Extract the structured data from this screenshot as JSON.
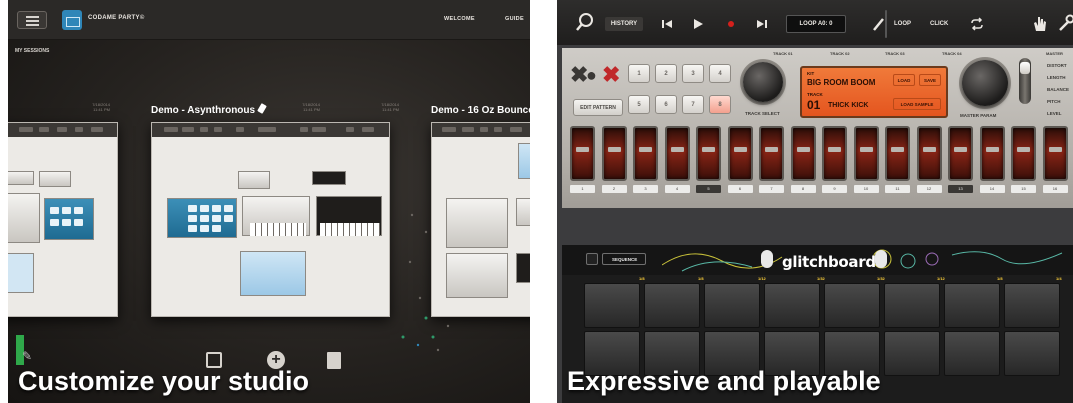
{
  "left_screen": {
    "header": {
      "brand": "CODAME PARTY©",
      "nav": [
        "WELCOME",
        "GUIDE"
      ]
    },
    "section_label": "MY SESSIONS",
    "sessions": [
      {
        "title": "Demo - Asynthronous",
        "date_line1": "7/18/2014",
        "date_line2": "11:41 PM"
      },
      {
        "title": "Demo - 16 Oz Bounce",
        "date_line1": "7/18/2014",
        "date_line2": "11:41 PM"
      }
    ],
    "prev_card_date": [
      "7/18/2014",
      "11:41 PM"
    ],
    "caption": "Customize your studio",
    "bottom_icons": [
      "mic-icon",
      "duplicate-icon",
      "add-icon",
      "trash-icon"
    ],
    "colors": {
      "background": "#25221f",
      "module_blue": "#2f86b8"
    }
  },
  "right_screen": {
    "toolbar": {
      "history": "HISTORY",
      "loop_readout": "LOOP A0: 0",
      "loop": "LOOP",
      "click": "CLICK"
    },
    "drum_machine": {
      "track_labels": [
        "TRACK 01",
        "TRACK 02",
        "TRACK 03",
        "TRACK 04"
      ],
      "master_label": "MASTER",
      "step_buttons": [
        "1",
        "2",
        "3",
        "4",
        "5",
        "6",
        "7",
        "8"
      ],
      "active_step": "8",
      "edit_pattern": "EDIT PATTERN",
      "track_select": "TRACK SELECT",
      "master_param": "MASTER PARAM",
      "lcd": {
        "kit_label": "KIT",
        "kit_name": "BIG ROOM BOOM",
        "track_label": "TRACK",
        "track_number": "01",
        "track_name": "THICK KICK",
        "buttons": [
          "LOAD",
          "SAVE",
          "LOAD SAMPLE"
        ]
      },
      "param_labels": [
        "DISTORT",
        "LENGTH",
        "BALANCE",
        "PITCH",
        "LEVEL"
      ],
      "pad_numbers": [
        "1",
        "2",
        "3",
        "4",
        "5",
        "6",
        "7",
        "8",
        "9",
        "10",
        "11",
        "12",
        "13",
        "14",
        "15",
        "16"
      ],
      "highlighted_pad_numbers": [
        "5",
        "13"
      ],
      "colors": {
        "lcd": "#ec6b2c",
        "pad": "#8a2516"
      }
    },
    "glitchboard": {
      "logo": "glitchboard",
      "sequence": "SEQUENCE",
      "step_labels": [
        "1/8",
        "1/8",
        "1/12",
        "1/32",
        "1/32",
        "1/12",
        "1/8",
        "1/4"
      ]
    },
    "caption": "Expressive and playable"
  }
}
